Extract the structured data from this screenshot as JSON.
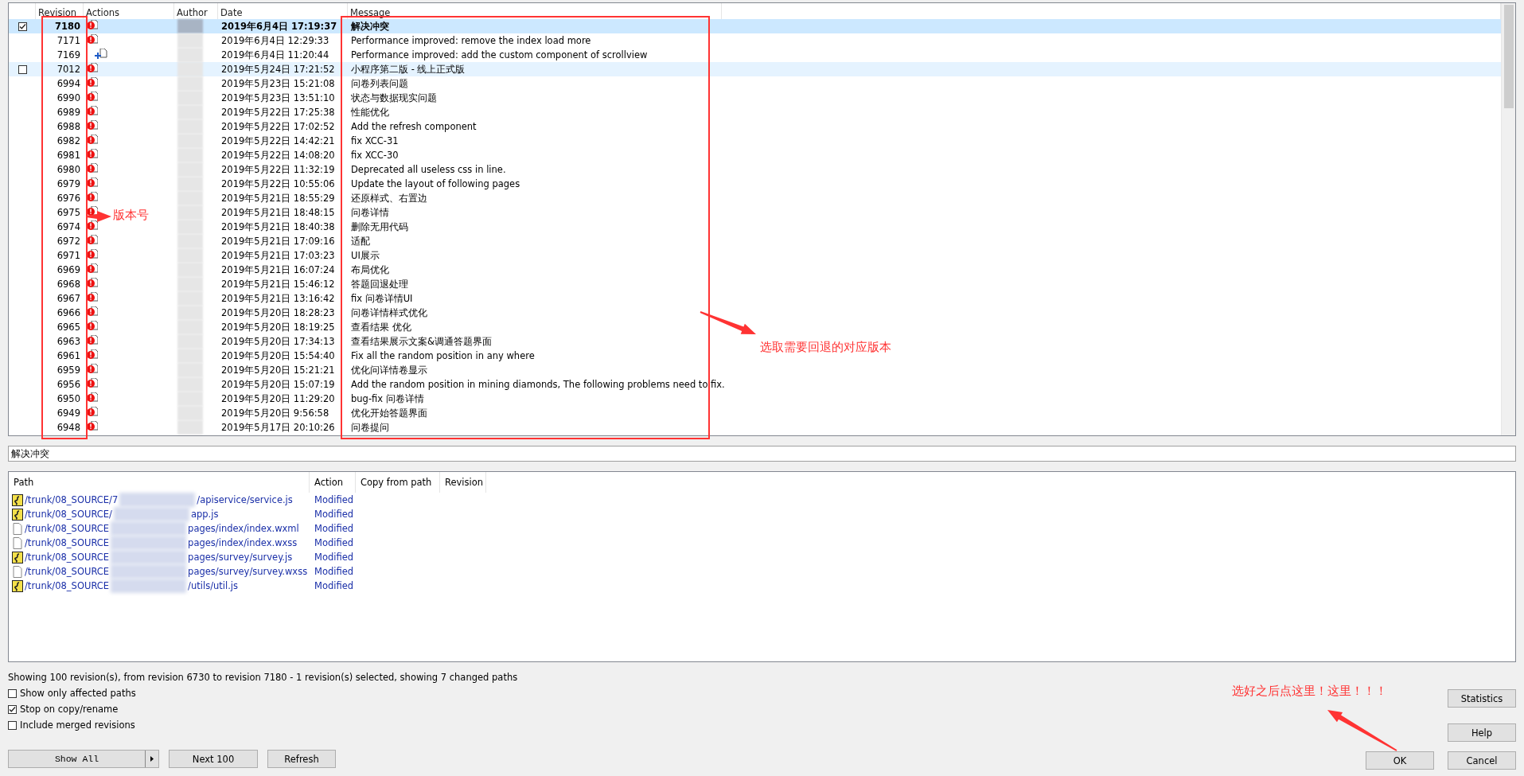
{
  "log": {
    "columns": [
      "Revision",
      "Actions",
      "Author",
      "Date",
      "Message"
    ],
    "rows": [
      {
        "revision": "7180",
        "kind": "modified",
        "date": "2019年6月4日 17:19:37",
        "message": "解决冲突",
        "selected": true,
        "hovered": false,
        "checkbox": {
          "checked": true
        }
      },
      {
        "revision": "7171",
        "kind": "modified",
        "date": "2019年6月4日 12:29:33",
        "message": "Performance improved: remove the index load more",
        "selected": false,
        "hovered": false
      },
      {
        "revision": "7169",
        "kind": "added",
        "date": "2019年6月4日 11:20:44",
        "message": "Performance improved: add the custom component of scrollview",
        "selected": false,
        "hovered": false
      },
      {
        "revision": "7012",
        "kind": "modified",
        "date": "2019年5月24日 17:21:52",
        "message": "小程序第二版 - 线上正式版",
        "selected": false,
        "hovered": true,
        "checkbox": {
          "checked": false
        }
      },
      {
        "revision": "6994",
        "kind": "modified",
        "date": "2019年5月23日 15:21:08",
        "message": "问卷列表问题",
        "selected": false,
        "hovered": false
      },
      {
        "revision": "6990",
        "kind": "modified",
        "date": "2019年5月23日 13:51:10",
        "message": "状态与数据现实问题",
        "selected": false,
        "hovered": false
      },
      {
        "revision": "6989",
        "kind": "modified",
        "date": "2019年5月22日 17:25:38",
        "message": "性能优化",
        "selected": false,
        "hovered": false
      },
      {
        "revision": "6988",
        "kind": "modified",
        "date": "2019年5月22日 17:02:52",
        "message": "Add the refresh component",
        "selected": false,
        "hovered": false
      },
      {
        "revision": "6982",
        "kind": "modified",
        "date": "2019年5月22日 14:42:21",
        "message": "fix XCC-31",
        "selected": false,
        "hovered": false
      },
      {
        "revision": "6981",
        "kind": "modified",
        "date": "2019年5月22日 14:08:20",
        "message": "fix XCC-30",
        "selected": false,
        "hovered": false
      },
      {
        "revision": "6980",
        "kind": "modified",
        "date": "2019年5月22日 11:32:19",
        "message": " Deprecated all useless css in line.",
        "selected": false,
        "hovered": false
      },
      {
        "revision": "6979",
        "kind": "modified",
        "date": "2019年5月22日 10:55:06",
        "message": "Update the layout of following pages",
        "selected": false,
        "hovered": false
      },
      {
        "revision": "6976",
        "kind": "modified",
        "date": "2019年5月21日 18:55:29",
        "message": "还原样式、右置边",
        "selected": false,
        "hovered": false
      },
      {
        "revision": "6975",
        "kind": "modified",
        "date": "2019年5月21日 18:48:15",
        "message": "问卷详情",
        "selected": false,
        "hovered": false
      },
      {
        "revision": "6974",
        "kind": "modified",
        "date": "2019年5月21日 18:40:38",
        "message": "删除无用代码",
        "selected": false,
        "hovered": false
      },
      {
        "revision": "6972",
        "kind": "modified",
        "date": "2019年5月21日 17:09:16",
        "message": "适配",
        "selected": false,
        "hovered": false
      },
      {
        "revision": "6971",
        "kind": "modified",
        "date": "2019年5月21日 17:03:23",
        "message": "UI展示",
        "selected": false,
        "hovered": false
      },
      {
        "revision": "6969",
        "kind": "modified",
        "date": "2019年5月21日 16:07:24",
        "message": "布局优化",
        "selected": false,
        "hovered": false
      },
      {
        "revision": "6968",
        "kind": "modified",
        "date": "2019年5月21日 15:46:12",
        "message": "答题回退处理",
        "selected": false,
        "hovered": false
      },
      {
        "revision": "6967",
        "kind": "modified",
        "date": "2019年5月21日 13:16:42",
        "message": "fix 问卷详情UI",
        "selected": false,
        "hovered": false
      },
      {
        "revision": "6966",
        "kind": "modified",
        "date": "2019年5月20日 18:28:23",
        "message": "问卷详情样式优化",
        "selected": false,
        "hovered": false
      },
      {
        "revision": "6965",
        "kind": "modified",
        "date": "2019年5月20日 18:19:25",
        "message": "查看结果 优化",
        "selected": false,
        "hovered": false
      },
      {
        "revision": "6963",
        "kind": "modified",
        "date": "2019年5月20日 17:34:13",
        "message": "查看结果展示文案&调通答题界面",
        "selected": false,
        "hovered": false
      },
      {
        "revision": "6961",
        "kind": "modified",
        "date": "2019年5月20日 15:54:40",
        "message": "Fix all the random position in any where",
        "selected": false,
        "hovered": false
      },
      {
        "revision": "6959",
        "kind": "modified",
        "date": "2019年5月20日 15:21:21",
        "message": "优化问详情卷显示",
        "selected": false,
        "hovered": false
      },
      {
        "revision": "6956",
        "kind": "modified",
        "date": "2019年5月20日 15:07:19",
        "message": "Add the random position in mining diamonds, The following problems need to fix.",
        "selected": false,
        "hovered": false
      },
      {
        "revision": "6950",
        "kind": "modified",
        "date": "2019年5月20日 11:29:20",
        "message": "bug-fix 问卷详情",
        "selected": false,
        "hovered": false
      },
      {
        "revision": "6949",
        "kind": "modified",
        "date": "2019年5月20日 9:56:58",
        "message": "优化开始答题界面",
        "selected": false,
        "hovered": false
      },
      {
        "revision": "6948",
        "kind": "modified",
        "date": "2019年5月17日 20:10:26",
        "message": "问卷提问",
        "selected": false,
        "hovered": false
      }
    ]
  },
  "message_box": {
    "value": "解决冲突"
  },
  "paths": {
    "columns": [
      "Path",
      "Action",
      "Copy from path",
      "Revision"
    ],
    "rows": [
      {
        "kind": "script",
        "path_start": "/trunk/08_SOURCE/7",
        "path_end": "/apiservice/service.js",
        "action": "Modified"
      },
      {
        "kind": "script",
        "path_start": "/trunk/08_SOURCE/",
        "path_end": "app.js",
        "action": "Modified"
      },
      {
        "kind": "file",
        "path_start": "/trunk/08_SOURCE",
        "path_end": "pages/index/index.wxml",
        "action": "Modified"
      },
      {
        "kind": "file",
        "path_start": "/trunk/08_SOURCE",
        "path_end": "pages/index/index.wxss",
        "action": "Modified"
      },
      {
        "kind": "script",
        "path_start": "/trunk/08_SOURCE",
        "path_end": "pages/survey/survey.js",
        "action": "Modified"
      },
      {
        "kind": "file",
        "path_start": "/trunk/08_SOURCE",
        "path_end": "pages/survey/survey.wxss",
        "action": "Modified"
      },
      {
        "kind": "script",
        "path_start": "/trunk/08_SOURCE",
        "path_end": "/utils/util.js",
        "action": "Modified"
      }
    ]
  },
  "status": "Showing 100 revision(s), from revision 6730 to revision 7180 - 1 revision(s) selected, showing 7 changed paths",
  "options": [
    {
      "label": "Show only affected paths",
      "checked": false
    },
    {
      "label": "Stop on copy/rename",
      "checked": true
    },
    {
      "label": "Include merged revisions",
      "checked": false
    }
  ],
  "buttons": {
    "show_all": "Show All",
    "next": "Next 100",
    "refresh": "Refresh",
    "statistics": "Statistics",
    "help": "Help",
    "ok": "OK",
    "cancel": "Cancel"
  },
  "annotations": {
    "revision_note": "版本号",
    "select_note": "选取需要回退的对应版本",
    "ok_note": "选好之后点这里！这里！！！"
  }
}
